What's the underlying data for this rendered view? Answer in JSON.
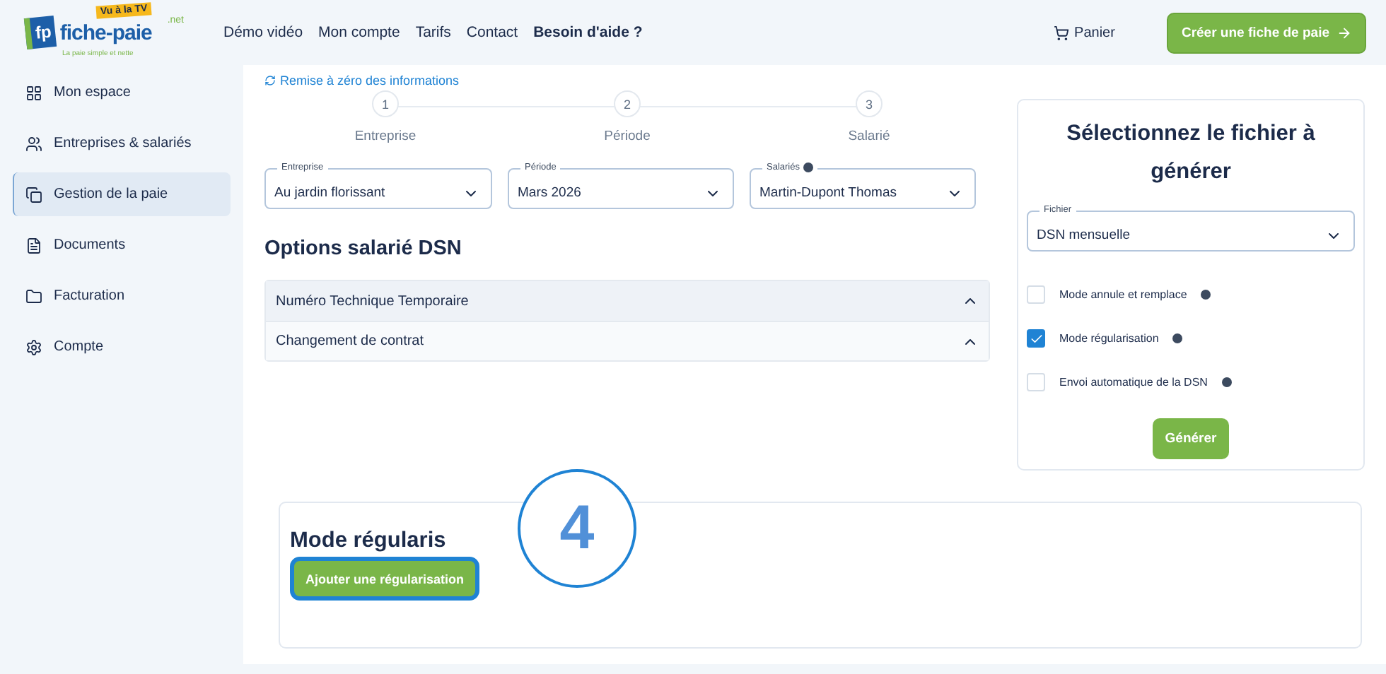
{
  "logo": {
    "mark": "fp",
    "name": "fiche-paie",
    "suffix": ".net",
    "badge": "Vu à la TV",
    "tagline": "La paie simple et nette"
  },
  "nav": [
    {
      "label": "Démo vidéo",
      "bold": false
    },
    {
      "label": "Mon compte",
      "bold": false
    },
    {
      "label": "Tarifs",
      "bold": false
    },
    {
      "label": "Contact",
      "bold": false
    },
    {
      "label": "Besoin d'aide ?",
      "bold": true
    }
  ],
  "cart": "Panier",
  "cta": "Créer une fiche de paie",
  "sidebar": {
    "items": [
      {
        "label": "Mon espace",
        "selected": false
      },
      {
        "label": "Entreprises & salariés",
        "selected": false
      },
      {
        "label": "Gestion de la paie",
        "selected": true
      },
      {
        "label": "Documents",
        "selected": false
      },
      {
        "label": "Facturation",
        "selected": false
      },
      {
        "label": "Compte",
        "selected": false
      }
    ]
  },
  "reset_link": "Remise à zéro des informations",
  "steps": [
    {
      "number": "1",
      "label": "Entreprise"
    },
    {
      "number": "2",
      "label": "Période"
    },
    {
      "number": "3",
      "label": "Salarié"
    }
  ],
  "selects": [
    {
      "label": "Entreprise",
      "value": "Au jardin florissant",
      "help": false
    },
    {
      "label": "Période",
      "value": "Mars 2026",
      "help": false
    },
    {
      "label": "Salariés",
      "value": "Martin-Dupont Thomas",
      "help": true
    }
  ],
  "options_title": "Options salarié DSN",
  "accordion": [
    {
      "label": "Numéro Technique Temporaire"
    },
    {
      "label": "Changement de contrat"
    }
  ],
  "file_panel": {
    "title": "Sélectionnez le fichier à générer",
    "select": {
      "label": "Fichier",
      "value": "DSN mensuelle"
    },
    "checkboxes": [
      {
        "label": "Mode annule et remplace",
        "checked": false
      },
      {
        "label": "Mode régularisation",
        "checked": true
      },
      {
        "label": "Envoi automatique de la DSN",
        "checked": false
      }
    ],
    "button": "Générer"
  },
  "regularisation": {
    "title": "Mode régularis",
    "button": "Ajouter une régularisation"
  },
  "callout": "4"
}
